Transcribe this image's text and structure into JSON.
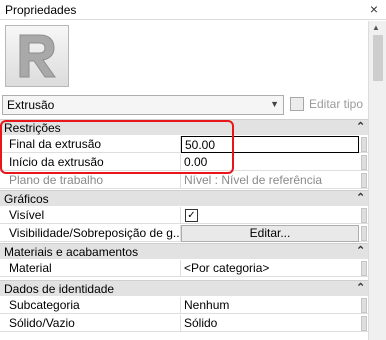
{
  "window": {
    "title": "Propriedades",
    "close_glyph": "×"
  },
  "preview": {
    "logo_icon": "revit-r-logo"
  },
  "type_selector": {
    "value": "Extrusão",
    "edit_type_label": "Editar tipo"
  },
  "colors": {
    "highlight": "#e8161b",
    "section_bg": "#e2e2e2"
  },
  "sections": {
    "restricoes": {
      "title": "Restrições",
      "rows": [
        {
          "name": "Final da extrusão",
          "value": "50.00"
        },
        {
          "name": "Início da extrusão",
          "value": "0.00"
        },
        {
          "name": "Plano de trabalho",
          "value": "Nível : Nível de referência"
        }
      ]
    },
    "graficos": {
      "title": "Gráficos",
      "rows": [
        {
          "name": "Visível",
          "value": "✓"
        },
        {
          "name": "Visibilidade/Sobreposição de g...",
          "value": "Editar..."
        }
      ]
    },
    "materiais": {
      "title": "Materiais e acabamentos",
      "rows": [
        {
          "name": "Material",
          "value": "<Por categoria>"
        }
      ]
    },
    "identidade": {
      "title": "Dados de identidade",
      "rows": [
        {
          "name": "Subcategoria",
          "value": "Nenhum"
        },
        {
          "name": "Sólido/Vazio",
          "value": "Sólido"
        }
      ]
    }
  }
}
